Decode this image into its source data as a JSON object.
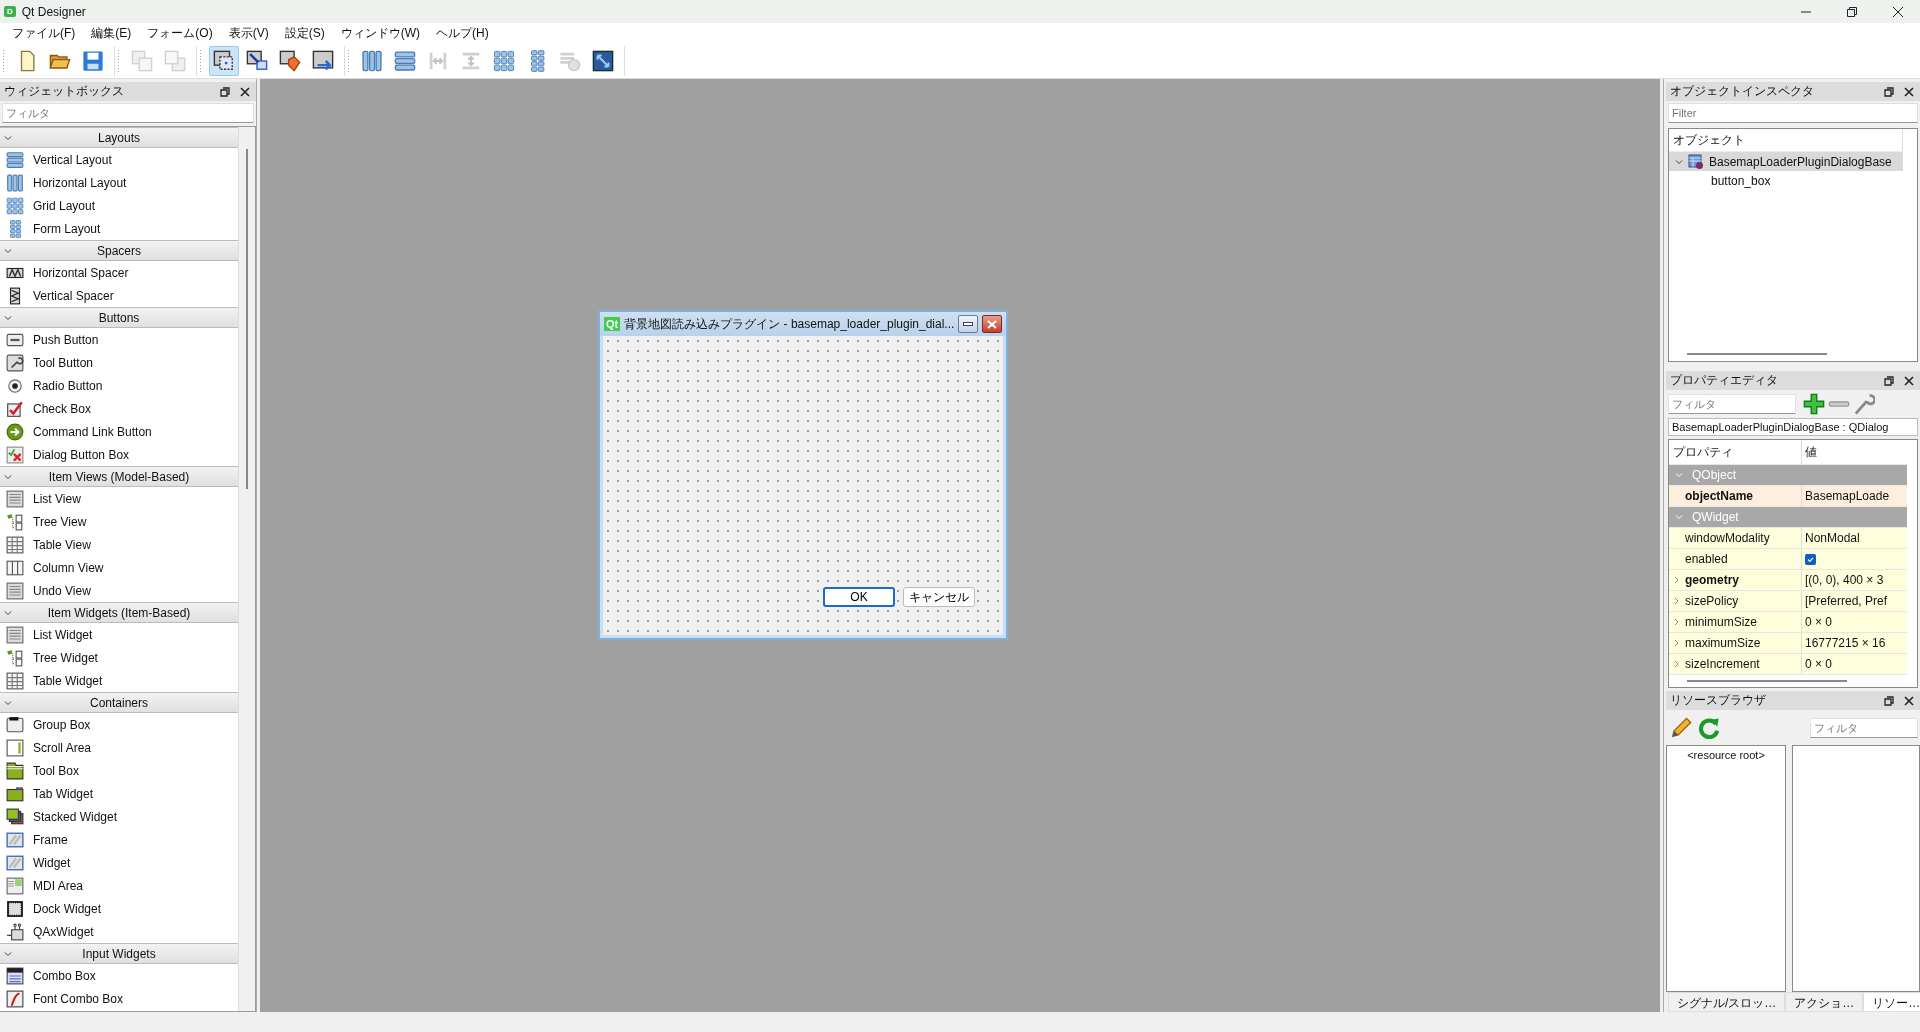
{
  "window": {
    "app_badge": "D",
    "title": "Qt Designer"
  },
  "menu": [
    "ファイル(F)",
    "編集(E)",
    "フォーム(O)",
    "表示(V)",
    "設定(S)",
    "ウィンドウ(W)",
    "ヘルプ(H)"
  ],
  "toolbar": [
    [
      {
        "kind": "new",
        "selected": false,
        "disabled": false
      },
      {
        "kind": "open",
        "selected": false,
        "disabled": false
      },
      {
        "kind": "save",
        "selected": false,
        "disabled": false
      }
    ],
    [
      {
        "kind": "back",
        "selected": false,
        "disabled": true
      },
      {
        "kind": "front",
        "selected": false,
        "disabled": true
      }
    ],
    [
      {
        "kind": "editwidgets",
        "selected": true,
        "disabled": false
      },
      {
        "kind": "signals",
        "selected": false,
        "disabled": false
      },
      {
        "kind": "buddies",
        "selected": false,
        "disabled": false
      },
      {
        "kind": "taborder",
        "selected": false,
        "disabled": false
      }
    ],
    [
      {
        "kind": "hlayout",
        "selected": false,
        "disabled": false
      },
      {
        "kind": "vlayout",
        "selected": false,
        "disabled": false
      },
      {
        "kind": "hsplit",
        "selected": false,
        "disabled": true
      },
      {
        "kind": "vsplit",
        "selected": false,
        "disabled": true
      },
      {
        "kind": "grid",
        "selected": false,
        "disabled": false
      },
      {
        "kind": "form",
        "selected": false,
        "disabled": false
      },
      {
        "kind": "break",
        "selected": false,
        "disabled": true
      },
      {
        "kind": "adjust",
        "selected": false,
        "disabled": false
      }
    ]
  ],
  "widget_box": {
    "title": "ウィジェットボックス",
    "filter": {
      "placeholder": "フィルタ"
    },
    "sections": [
      {
        "title": "Layouts",
        "expanded": true,
        "items": [
          {
            "label": "Vertical Layout",
            "kind": "vlayout"
          },
          {
            "label": "Horizontal Layout",
            "kind": "hlayout"
          },
          {
            "label": "Grid Layout",
            "kind": "grid"
          },
          {
            "label": "Form Layout",
            "kind": "form"
          }
        ]
      },
      {
        "title": "Spacers",
        "expanded": true,
        "items": [
          {
            "label": "Horizontal Spacer",
            "kind": "hspacer"
          },
          {
            "label": "Vertical Spacer",
            "kind": "vspacer"
          }
        ]
      },
      {
        "title": "Buttons",
        "expanded": true,
        "items": [
          {
            "label": "Push Button",
            "kind": "pushbutton"
          },
          {
            "label": "Tool Button",
            "kind": "toolbutton"
          },
          {
            "label": "Radio Button",
            "kind": "radio"
          },
          {
            "label": "Check Box",
            "kind": "checkbox"
          },
          {
            "label": "Command Link Button",
            "kind": "cmdlink"
          },
          {
            "label": "Dialog Button Box",
            "kind": "dialogbox"
          }
        ]
      },
      {
        "title": "Item Views (Model-Based)",
        "expanded": true,
        "items": [
          {
            "label": "List View",
            "kind": "list"
          },
          {
            "label": "Tree View",
            "kind": "tree"
          },
          {
            "label": "Table View",
            "kind": "table"
          },
          {
            "label": "Column View",
            "kind": "columns"
          },
          {
            "label": "Undo View",
            "kind": "list"
          }
        ]
      },
      {
        "title": "Item Widgets (Item-Based)",
        "expanded": true,
        "items": [
          {
            "label": "List Widget",
            "kind": "list"
          },
          {
            "label": "Tree Widget",
            "kind": "tree"
          },
          {
            "label": "Table Widget",
            "kind": "table"
          }
        ]
      },
      {
        "title": "Containers",
        "expanded": true,
        "items": [
          {
            "label": "Group Box",
            "kind": "groupbox"
          },
          {
            "label": "Scroll Area",
            "kind": "scroll"
          },
          {
            "label": "Tool Box",
            "kind": "toolbox"
          },
          {
            "label": "Tab Widget",
            "kind": "tab"
          },
          {
            "label": "Stacked Widget",
            "kind": "stacked"
          },
          {
            "label": "Frame",
            "kind": "frame"
          },
          {
            "label": "Widget",
            "kind": "frame"
          },
          {
            "label": "MDI Area",
            "kind": "mdi"
          },
          {
            "label": "Dock Widget",
            "kind": "dock"
          },
          {
            "label": "QAxWidget",
            "kind": "qax"
          }
        ]
      },
      {
        "title": "Input Widgets",
        "expanded": true,
        "items": [
          {
            "label": "Combo Box",
            "kind": "combo"
          },
          {
            "label": "Font Combo Box",
            "kind": "font"
          }
        ]
      }
    ]
  },
  "form_window": {
    "app_badge": "Qt",
    "title": "背景地図読み込みプラグイン - basemap_loader_plugin_dial...",
    "buttons": [
      {
        "label": "OK",
        "default": true
      },
      {
        "label": "キャンセル",
        "default": false
      }
    ]
  },
  "object_inspector": {
    "title": "オブジェクトインスペクタ",
    "filter": {
      "placeholder": "Filter"
    },
    "column": "オブジェクト",
    "tree": [
      {
        "label": "BasemapLoaderPluginDialogBase",
        "selected": true,
        "expanded": true,
        "children": [
          {
            "label": "button_box",
            "selected": false
          }
        ]
      }
    ]
  },
  "property_editor": {
    "title": "プロパティエディタ",
    "filter": {
      "placeholder": "フィルタ"
    },
    "object_class": "BasemapLoaderPluginDialogBase : QDialog",
    "columns": [
      "プロパティ",
      "値"
    ],
    "groups": [
      {
        "name": "QObject",
        "expanded": true,
        "color": "#fdeedd",
        "properties": [
          {
            "name": "objectName",
            "kind": "text",
            "value": "BasemapLoade",
            "changed": true,
            "expandable": false
          }
        ]
      },
      {
        "name": "QWidget",
        "expanded": true,
        "color": "#fffedc",
        "properties": [
          {
            "name": "windowModality",
            "kind": "text",
            "value": "NonModal",
            "changed": false,
            "expandable": false
          },
          {
            "name": "enabled",
            "kind": "checkbox",
            "checked": true,
            "changed": false,
            "expandable": false
          },
          {
            "name": "geometry",
            "kind": "text",
            "value": "[(0, 0), 400 × 3",
            "changed": true,
            "expandable": true
          },
          {
            "name": "sizePolicy",
            "kind": "text",
            "value": "[Preferred, Pref",
            "changed": false,
            "expandable": true
          },
          {
            "name": "minimumSize",
            "kind": "text",
            "value": "0 × 0",
            "changed": false,
            "expandable": true
          },
          {
            "name": "maximumSize",
            "kind": "text",
            "value": "16777215 × 16",
            "changed": false,
            "expandable": true
          },
          {
            "name": "sizeIncrement",
            "kind": "text",
            "value": "0 × 0",
            "changed": false,
            "expandable": true
          }
        ]
      }
    ]
  },
  "resource_browser": {
    "title": "リソースブラウザ",
    "filter": {
      "placeholder": "フィルタ"
    },
    "tree": [
      "<resource root>"
    ]
  },
  "bottom_tabs": [
    {
      "label": "シグナル/スロッ…",
      "selected": false
    },
    {
      "label": "アクショ…",
      "selected": false
    },
    {
      "label": "リソー…",
      "selected": true
    }
  ]
}
